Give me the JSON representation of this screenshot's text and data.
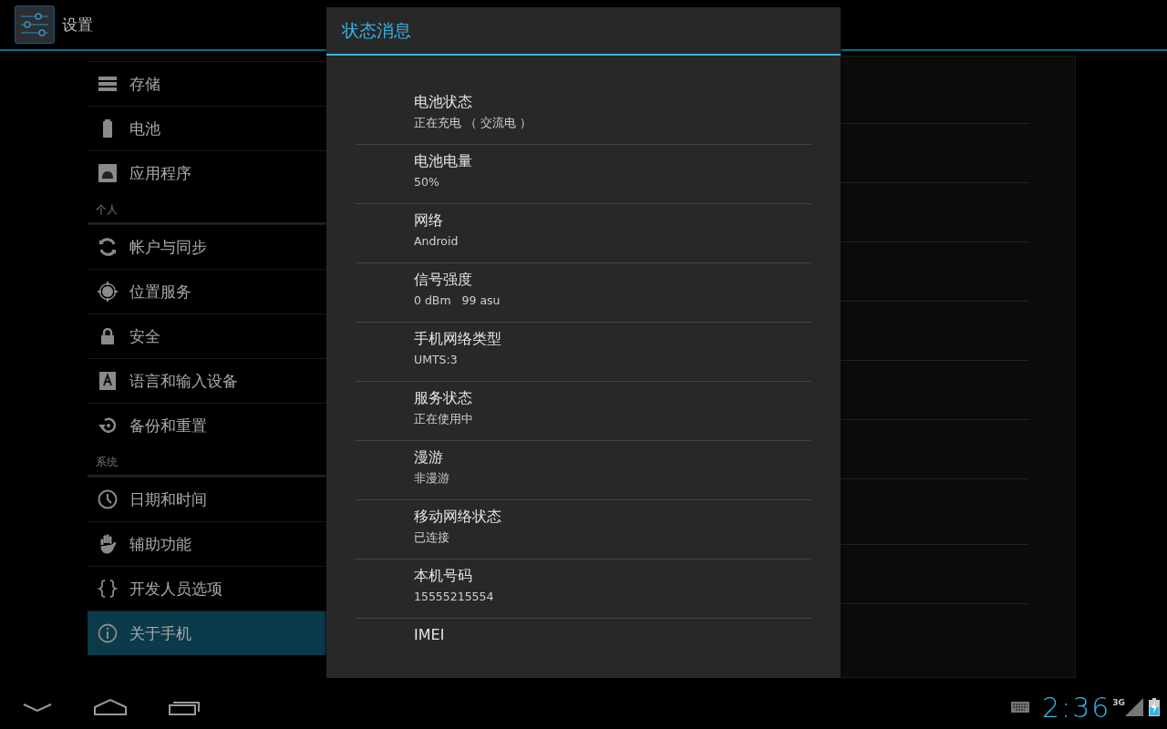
{
  "action_bar": {
    "title": "设置"
  },
  "sidebar": {
    "items": [
      {
        "kind": "item",
        "label": "存储",
        "selected": false
      },
      {
        "kind": "item",
        "label": "电池",
        "selected": false
      },
      {
        "kind": "item",
        "label": "应用程序",
        "selected": false
      },
      {
        "kind": "header",
        "label": "个人"
      },
      {
        "kind": "item",
        "label": "帐户与同步",
        "selected": false
      },
      {
        "kind": "item",
        "label": "位置服务",
        "selected": false
      },
      {
        "kind": "item",
        "label": "安全",
        "selected": false
      },
      {
        "kind": "item",
        "label": "语言和输入设备",
        "selected": false
      },
      {
        "kind": "item",
        "label": "备份和重置",
        "selected": false
      },
      {
        "kind": "header",
        "label": "系统"
      },
      {
        "kind": "item",
        "label": "日期和时间",
        "selected": false
      },
      {
        "kind": "item",
        "label": "辅助功能",
        "selected": false
      },
      {
        "kind": "item",
        "label": "开发人员选项",
        "selected": false
      },
      {
        "kind": "item",
        "label": "关于手机",
        "selected": true
      }
    ]
  },
  "dialog": {
    "title": "状态消息",
    "rows": [
      {
        "title": "电池状态",
        "value": "正在充电 （ 交流电 ）"
      },
      {
        "title": "电池电量",
        "value": "50%"
      },
      {
        "title": "网络",
        "value": "Android"
      },
      {
        "title": "信号强度",
        "value": "0 dBm   99 asu"
      },
      {
        "title": "手机网络类型",
        "value": "UMTS:3"
      },
      {
        "title": "服务状态",
        "value": "正在使用中"
      },
      {
        "title": "漫游",
        "value": "非漫游"
      },
      {
        "title": "移动网络状态",
        "value": "已连接"
      },
      {
        "title": "本机号码",
        "value": "15555215554"
      },
      {
        "title": "IMEI"
      }
    ]
  },
  "status_bar": {
    "network": "3G",
    "clock": "2:36"
  }
}
